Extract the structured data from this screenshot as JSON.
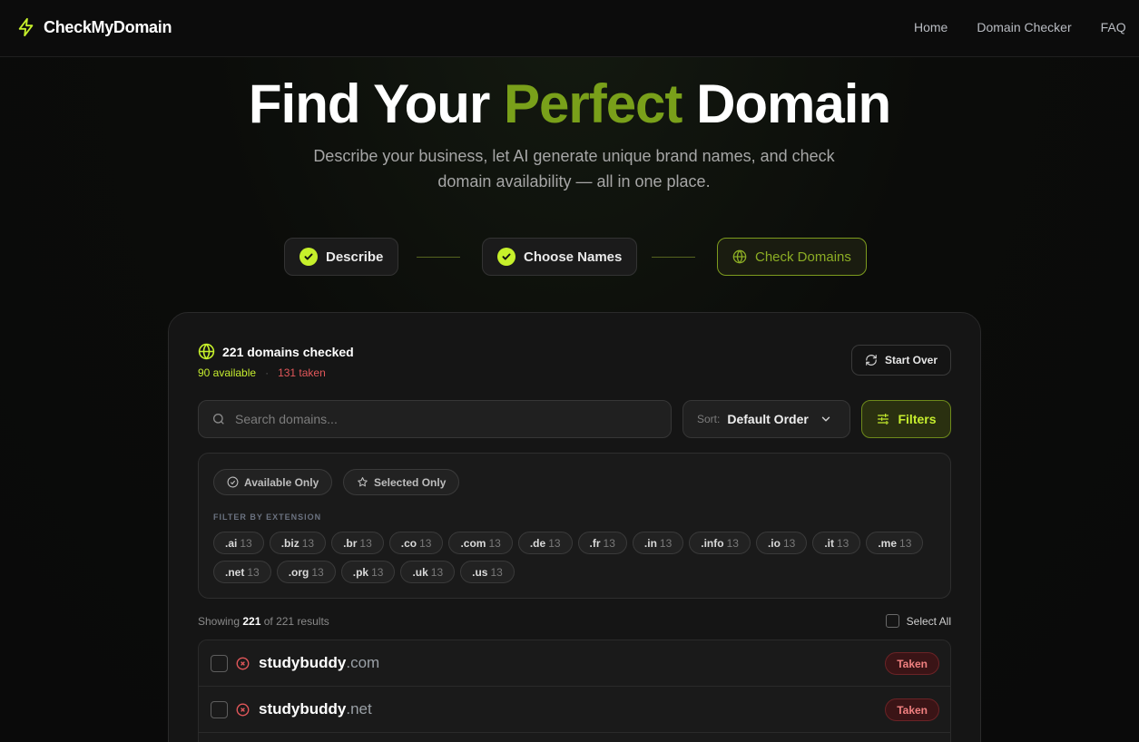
{
  "brand": {
    "name": "CheckMyDomain",
    "accent": "#c6f02b"
  },
  "nav": {
    "links": [
      "Home",
      "Domain Checker",
      "FAQ"
    ]
  },
  "hero": {
    "title_part1": "Find Your ",
    "title_accent": "Perfect",
    "title_part2": " Domain",
    "subtitle": "Describe your business, let AI generate unique brand names, and check domain availability — all in one place."
  },
  "steps": [
    {
      "label": "Describe",
      "state": "done"
    },
    {
      "label": "Choose Names",
      "state": "done"
    },
    {
      "label": "Check Domains",
      "state": "active"
    }
  ],
  "summary": {
    "title": "221 domains checked",
    "available": "90 available",
    "separator": "·",
    "taken": "131 taken",
    "start_over": "Start Over"
  },
  "search": {
    "placeholder": "Search domains..."
  },
  "sort": {
    "label": "Sort:",
    "value": "Default Order"
  },
  "filters": {
    "button": "Filters",
    "available_only": "Available Only",
    "selected_only": "Selected Only",
    "ext_heading": "FILTER BY EXTENSION",
    "extensions": [
      {
        "ext": ".ai",
        "count": "13"
      },
      {
        "ext": ".biz",
        "count": "13"
      },
      {
        "ext": ".br",
        "count": "13"
      },
      {
        "ext": ".co",
        "count": "13"
      },
      {
        "ext": ".com",
        "count": "13"
      },
      {
        "ext": ".de",
        "count": "13"
      },
      {
        "ext": ".fr",
        "count": "13"
      },
      {
        "ext": ".in",
        "count": "13"
      },
      {
        "ext": ".info",
        "count": "13"
      },
      {
        "ext": ".io",
        "count": "13"
      },
      {
        "ext": ".it",
        "count": "13"
      },
      {
        "ext": ".me",
        "count": "13"
      },
      {
        "ext": ".net",
        "count": "13"
      },
      {
        "ext": ".org",
        "count": "13"
      },
      {
        "ext": ".pk",
        "count": "13"
      },
      {
        "ext": ".uk",
        "count": "13"
      },
      {
        "ext": ".us",
        "count": "13"
      }
    ]
  },
  "results": {
    "showing_prefix": "Showing ",
    "showing_count": "221",
    "showing_suffix": " of 221 results",
    "select_all": "Select All",
    "rows": [
      {
        "name": "studybuddy",
        "tld": ".com",
        "status": "Taken"
      },
      {
        "name": "studybuddy",
        "tld": ".net",
        "status": "Taken"
      }
    ]
  }
}
